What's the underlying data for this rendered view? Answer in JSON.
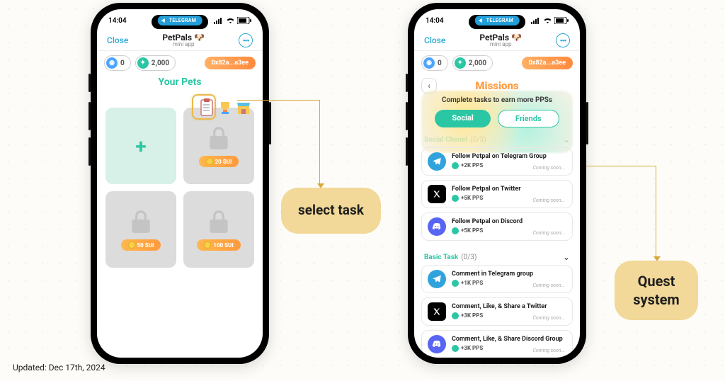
{
  "updated_label": "Updated: Dec 17th, 2024",
  "statusbar": {
    "time": "14:04",
    "carrier_pill": "TELEGRAM"
  },
  "app_header": {
    "close": "Close",
    "title": "PetPals",
    "subtitle": "mini app"
  },
  "balances": {
    "sui": "0",
    "pps": "2,000",
    "address": "0x82a...a3ee"
  },
  "home": {
    "section_title": "Your Pets",
    "slots": [
      {
        "type": "add"
      },
      {
        "type": "locked",
        "cost": "20 SUI"
      },
      {
        "type": "locked",
        "cost": "50 SUI"
      },
      {
        "type": "locked",
        "cost": "100 SUI"
      }
    ]
  },
  "missions": {
    "title": "Missions",
    "subtitle": "Complete tasks to earn more PPSs",
    "tabs": {
      "active": "Social",
      "inactive": "Friends"
    },
    "sections": [
      {
        "label": "Social Chanel",
        "count": "(0/3)",
        "tasks": [
          {
            "icon": "tg",
            "title": "Follow Petpal on Telegram Group",
            "reward": "+2K PPS",
            "status": "Coming soon..."
          },
          {
            "icon": "x",
            "title": "Follow Petpal on Twitter",
            "reward": "+5K PPS",
            "status": "Coming soon..."
          },
          {
            "icon": "dc",
            "title": "Follow Petpal on Discord",
            "reward": "+5K PPS",
            "status": "Coming soon..."
          }
        ]
      },
      {
        "label": "Basic Task",
        "count": "(0/3)",
        "tasks": [
          {
            "icon": "tg",
            "title": "Comment in Telegram group",
            "reward": "+1K PPS",
            "status": "Coming soon..."
          },
          {
            "icon": "x",
            "title": "Comment, Like, & Share a Twitter",
            "reward": "+3K PPS",
            "status": "Coming soon..."
          },
          {
            "icon": "dc",
            "title": "Comment, Like, & Share Discord Group",
            "reward": "+3K PPS",
            "status": "Coming soon..."
          }
        ]
      }
    ]
  },
  "callouts": {
    "left": "select task",
    "right_l1": "Quest",
    "right_l2": "system"
  }
}
